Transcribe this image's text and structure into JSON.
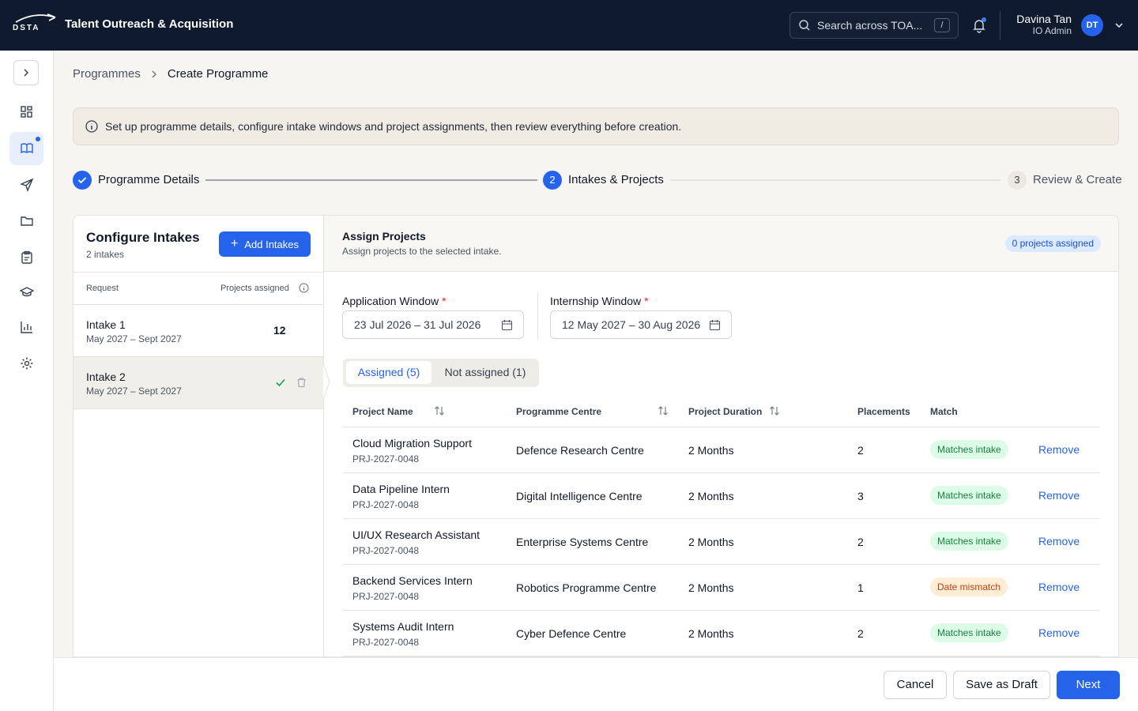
{
  "header": {
    "logo_text": "DSTA",
    "app_title": "Talent Outreach & Acquisition",
    "search_placeholder": "Search across TOA...",
    "search_shortcut": "/",
    "user_name": "Davina Tan",
    "user_role": "IO Admin",
    "user_initials": "DT"
  },
  "sidebar": {
    "items": [
      {
        "icon": "dashboard-icon"
      },
      {
        "icon": "book-icon",
        "active": true
      },
      {
        "icon": "send-icon"
      },
      {
        "icon": "folder-icon"
      },
      {
        "icon": "clipboard-icon"
      },
      {
        "icon": "graduation-cap-icon"
      },
      {
        "icon": "bar-chart-icon"
      },
      {
        "icon": "settings-icon"
      }
    ]
  },
  "breadcrumb": {
    "parent": "Programmes",
    "current": "Create Programme"
  },
  "info_banner": "Set up programme details, configure intake windows and project assignments, then review everything before creation.",
  "stepper": {
    "steps": [
      {
        "number": "1",
        "label": "Programme Details",
        "status": "complete"
      },
      {
        "number": "2",
        "label": "Intakes & Projects",
        "status": "current"
      },
      {
        "number": "3",
        "label": "Review & Create",
        "status": "upcoming"
      }
    ]
  },
  "intakes_panel": {
    "title": "Configure Intakes",
    "subtitle": "2 intakes",
    "add_button": "Add Intakes",
    "col_request": "Request",
    "col_projects": "Projects assigned",
    "intakes": [
      {
        "name": "Intake 1",
        "dates": "May 2027 – Sept 2027",
        "projects": "12"
      },
      {
        "name": "Intake 2",
        "dates": "May 2027 – Sept 2027",
        "projects": ""
      }
    ]
  },
  "assign_panel": {
    "title": "Assign Projects",
    "subtitle": "Assign projects to the selected intake.",
    "badge": "0 projects assigned",
    "application_window_label": "Application Window",
    "application_window_value": "23 Jul 2026 – 31 Jul 2026",
    "internship_window_label": "Internship Window",
    "internship_window_value": "12 May 2027 – 30 Aug 2026",
    "required_mark": "*",
    "tab_assigned": "Assigned (5)",
    "tab_not_assigned": "Not assigned (1)",
    "columns": {
      "project_name": "Project Name",
      "programme_centre": "Programme Centre",
      "project_duration": "Project Duration",
      "placements": "Placements",
      "match": "Match"
    },
    "rows": [
      {
        "name": "Cloud Migration Support",
        "code": "PRJ-2027-0048",
        "centre": "Defence Research Centre",
        "duration": "2 Months",
        "placements": "2",
        "match": "Matches intake",
        "match_status": "ok",
        "action": "Remove"
      },
      {
        "name": "Data Pipeline Intern",
        "code": "PRJ-2027-0048",
        "centre": "Digital Intelligence Centre",
        "duration": "2 Months",
        "placements": "3",
        "match": "Matches intake",
        "match_status": "ok",
        "action": "Remove"
      },
      {
        "name": "UI/UX Research Assistant",
        "code": "PRJ-2027-0048",
        "centre": "Enterprise Systems Centre",
        "duration": "2 Months",
        "placements": "2",
        "match": "Matches intake",
        "match_status": "ok",
        "action": "Remove"
      },
      {
        "name": "Backend Services Intern",
        "code": "PRJ-2027-0048",
        "centre": "Robotics Programme Centre",
        "duration": "2 Months",
        "placements": "1",
        "match": "Date mismatch",
        "match_status": "warn",
        "action": "Remove"
      },
      {
        "name": "Systems Audit Intern",
        "code": "PRJ-2027-0048",
        "centre": "Cyber Defence Centre",
        "duration": "2 Months",
        "placements": "2",
        "match": "Matches intake",
        "match_status": "ok",
        "action": "Remove"
      }
    ]
  },
  "footer": {
    "cancel": "Cancel",
    "save_draft": "Save as Draft",
    "next": "Next"
  },
  "colors": {
    "topbar": "#0f1a2e",
    "primary": "#2563eb",
    "match_ok": "#15803d",
    "match_warn": "#c2410c"
  }
}
